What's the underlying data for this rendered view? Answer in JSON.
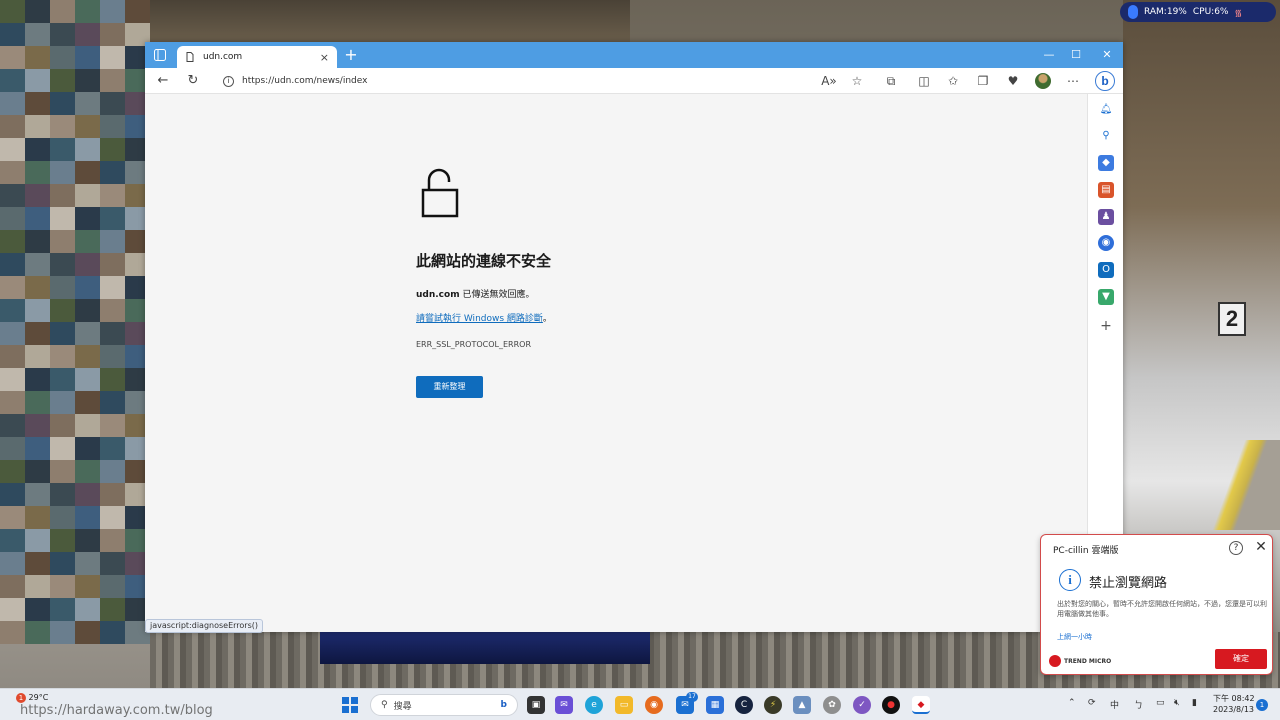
{
  "system_monitor": {
    "ram": "RAM:19%",
    "cpu": "CPU:6%"
  },
  "browser": {
    "tab_title": "udn.com",
    "url": "https://udn.com/news/index",
    "status_text": "javascript:diagnoseErrors()"
  },
  "error_page": {
    "title": "此網站的連線不安全",
    "domain": "udn.com",
    "desc_suffix": " 已傳送無效回應。",
    "link_text": "請嘗試執行 Windows 網路診斷",
    "link_suffix": "。",
    "error_code": "ERR_SSL_PROTOCOL_ERROR",
    "reload_label": "重新整理"
  },
  "popup": {
    "header": "PC-cillin 雲端版",
    "title": "禁止瀏覽網路",
    "body": "出於對您的關心，暫時不允許您開啟任何網站，不過，您還是可以利用電腦做其他事。",
    "link": "上網一小時",
    "brand": "TREND MICRO",
    "ok_label": "確定"
  },
  "taskbar": {
    "temperature": "29°C",
    "weather_badge": "1",
    "watermark": "https://hardaway.com.tw/blog",
    "search_placeholder": "搜尋",
    "mail_badge": "17",
    "ime": "中",
    "time": "下午 08:42",
    "date": "2023/8/13",
    "notification_count": "1"
  },
  "colors": {
    "accent": "#4e9de3",
    "link": "#0f6cbd",
    "trend_red": "#d71920"
  }
}
